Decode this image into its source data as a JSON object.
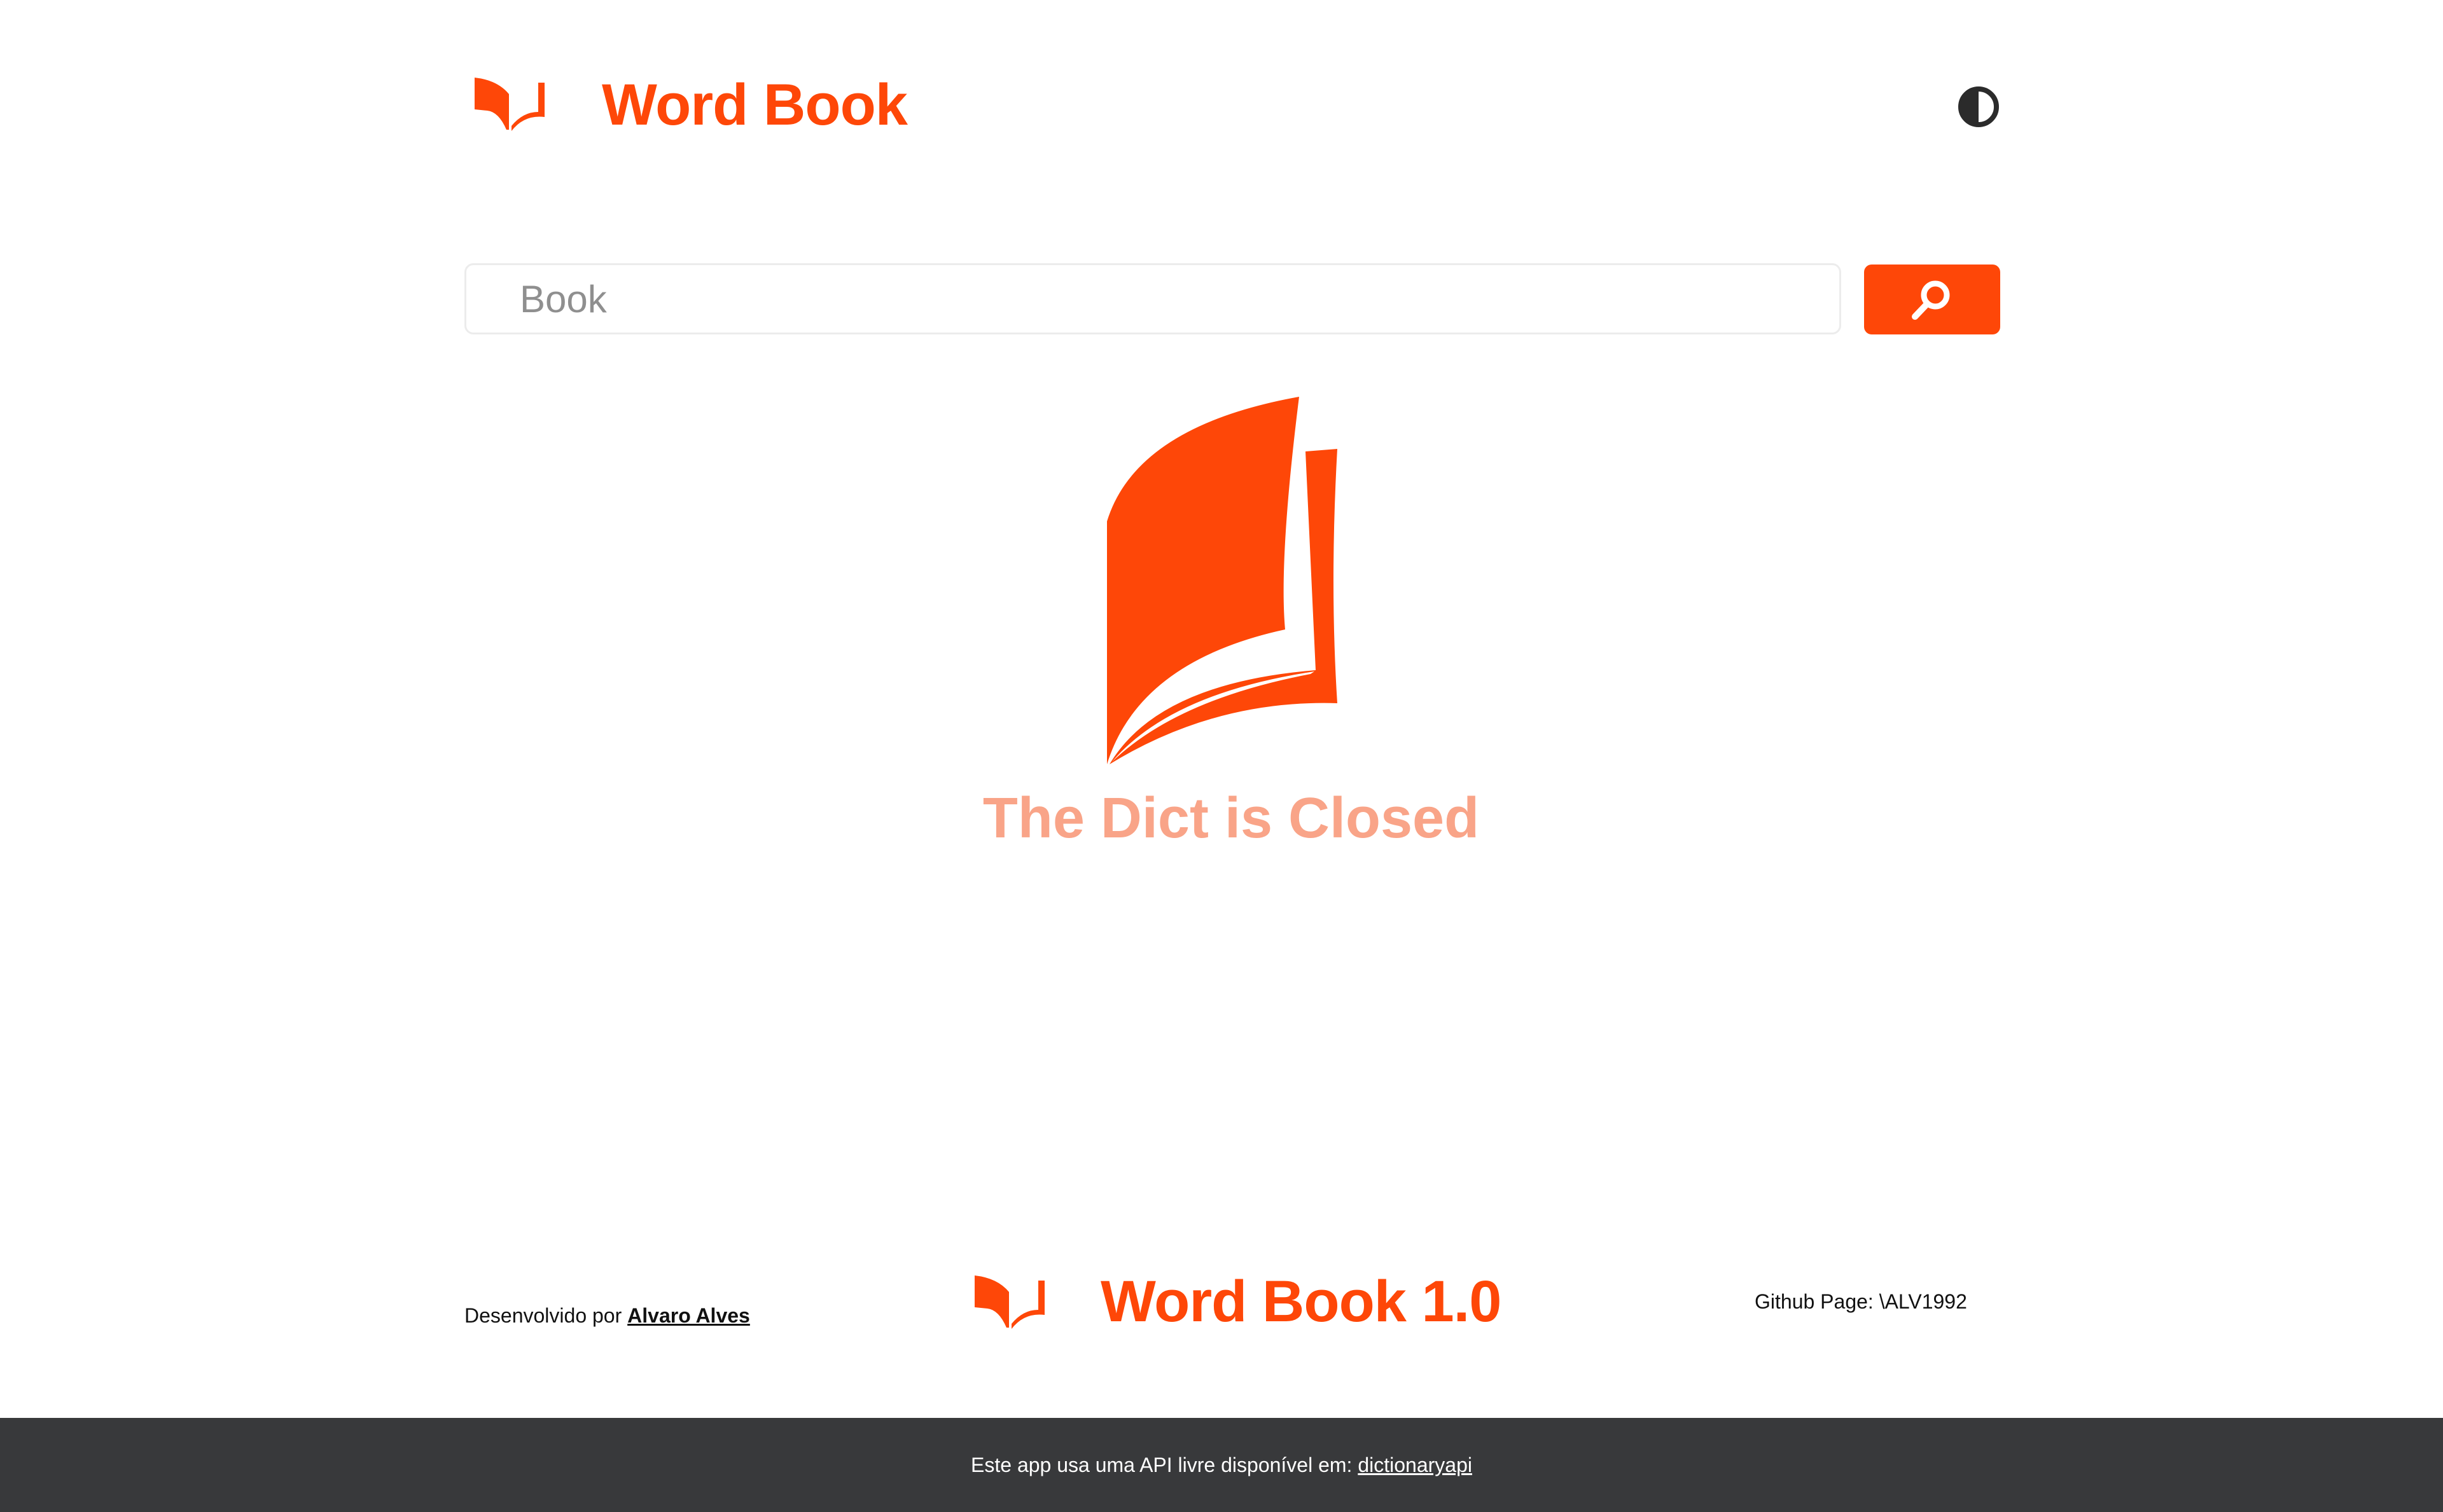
{
  "app": {
    "title": "Word Book",
    "accent_color": "#fe4708",
    "muted_accent_color": "#f9a488"
  },
  "header": {
    "logo_icon": "open-book-icon",
    "title": "Word Book",
    "theme_toggle_icon": "contrast-half-circle-icon"
  },
  "search": {
    "value": "",
    "placeholder": "Book",
    "button_icon": "search-icon"
  },
  "empty_state": {
    "icon": "open-book-icon",
    "message": "The Dict is Closed"
  },
  "footer": {
    "credit_prefix": "Desenvolvido por",
    "credit_author": "Alvaro Alves",
    "logo_icon": "open-book-icon",
    "title": "Word Book 1.0",
    "github": "Github Page: \\ALV1992"
  },
  "bottom_bar": {
    "text": "Este app usa uma API livre disponível em:",
    "link_label": "dictionaryapi",
    "background": "#38393b"
  }
}
